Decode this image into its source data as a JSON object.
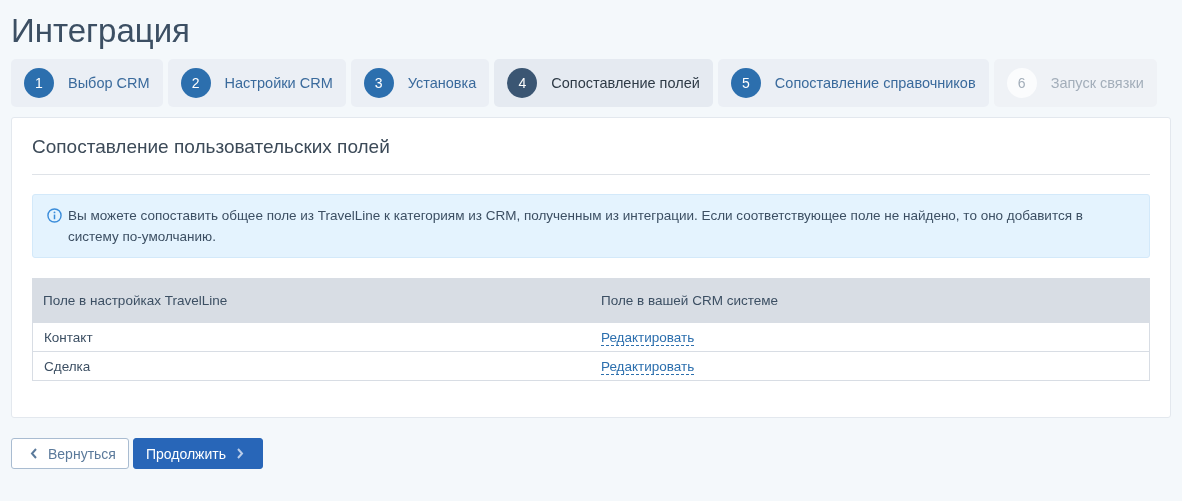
{
  "title": "Интеграция",
  "steps": [
    {
      "number": "1",
      "label": "Выбор CRM",
      "selected": false,
      "disabled": false
    },
    {
      "number": "2",
      "label": "Настройки CRM",
      "selected": false,
      "disabled": false
    },
    {
      "number": "3",
      "label": "Установка",
      "selected": false,
      "disabled": false
    },
    {
      "number": "4",
      "label": "Сопоставление полей",
      "selected": true,
      "disabled": false
    },
    {
      "number": "5",
      "label": "Сопоставление справочников",
      "selected": false,
      "disabled": false
    },
    {
      "number": "6",
      "label": "Запуск связки",
      "selected": false,
      "disabled": true
    }
  ],
  "card": {
    "heading": "Сопоставление пользовательских полей",
    "info": "Вы можете сопоставить общее поле из TravelLine к категориям из CRM, полученным из интеграции. Если соответствующее поле не найдено, то оно добавится в систему по-умолчанию.",
    "table": {
      "columns": [
        "Поле в настройках TravelLine",
        "Поле в вашей CRM системе"
      ],
      "rows": [
        {
          "field": "Контакт",
          "action": "Редактировать"
        },
        {
          "field": "Сделка",
          "action": "Редактировать"
        }
      ]
    }
  },
  "buttons": {
    "back": "Вернуться",
    "next": "Продолжить"
  }
}
